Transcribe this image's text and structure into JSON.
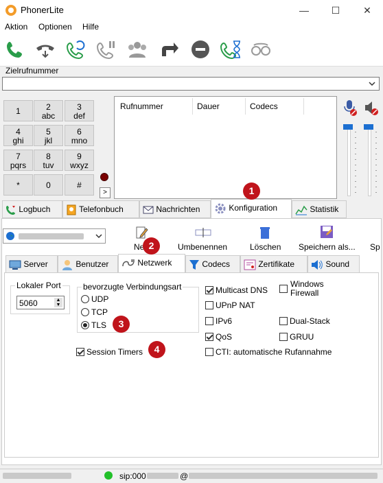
{
  "window": {
    "title": "PhonerLite",
    "controls": [
      "—",
      "☐",
      "✕"
    ]
  },
  "menu": [
    "Aktion",
    "Optionen",
    "Hilfe"
  ],
  "toolbar_icons": [
    "call-icon",
    "hangup-icon",
    "redial-icon",
    "hold-icon",
    "conference-icon",
    "transfer-icon",
    "reject-icon",
    "call-wait-icon",
    "anonymous-icon"
  ],
  "number": {
    "label": "Zielrufnummer",
    "value": ""
  },
  "keypad": [
    {
      "d": "1",
      "l": ""
    },
    {
      "d": "2",
      "l": "abc"
    },
    {
      "d": "3",
      "l": "def"
    },
    {
      "d": "4",
      "l": "ghi"
    },
    {
      "d": "5",
      "l": "jkl"
    },
    {
      "d": "6",
      "l": "mno"
    },
    {
      "d": "7",
      "l": "pqrs"
    },
    {
      "d": "8",
      "l": "tuv"
    },
    {
      "d": "9",
      "l": "wxyz"
    },
    {
      "d": "*",
      "l": ""
    },
    {
      "d": "0",
      "l": ""
    },
    {
      "d": "#",
      "l": ""
    }
  ],
  "expand_label": ">",
  "calls_table": {
    "columns": [
      "Rufnummer",
      "Dauer",
      "Codecs"
    ]
  },
  "main_tabs": [
    "Logbuch",
    "Telefonbuch",
    "Nachrichten",
    "Konfiguration",
    "Statistik"
  ],
  "profile_actions": [
    "Neu",
    "Umbenennen",
    "Löschen",
    "Speichern als...",
    "Sp"
  ],
  "sub_tabs": [
    "Server",
    "Benutzer",
    "Netzwerk",
    "Codecs",
    "Zertifikate",
    "Sound"
  ],
  "network": {
    "local_port_label": "Lokaler Port",
    "local_port_value": "5060",
    "conn_group_label": "bevorzugte Verbindungsart",
    "conn_options": [
      "UDP",
      "TCP",
      "TLS"
    ],
    "conn_selected": "TLS",
    "session_timers": "Session Timers",
    "options": [
      {
        "label": "Multicast DNS",
        "checked": true
      },
      {
        "label": "UPnP NAT",
        "checked": false
      },
      {
        "label": "IPv6",
        "checked": false
      },
      {
        "label": "QoS",
        "checked": true
      },
      {
        "label": "CTI: automatische Rufannahme",
        "checked": false
      }
    ],
    "options_right": [
      {
        "label": "Windows Firewall",
        "checked": false
      },
      {
        "label": "Dual-Stack",
        "checked": false
      },
      {
        "label": "GRUU",
        "checked": false
      }
    ]
  },
  "badges": [
    "1",
    "2",
    "3",
    "4"
  ],
  "status": {
    "sip_prefix": "sip:000",
    "at": "@"
  },
  "colors": {
    "badge": "#c0141b",
    "accent_green": "#2a9d4a",
    "status_led": "#22c02a"
  }
}
